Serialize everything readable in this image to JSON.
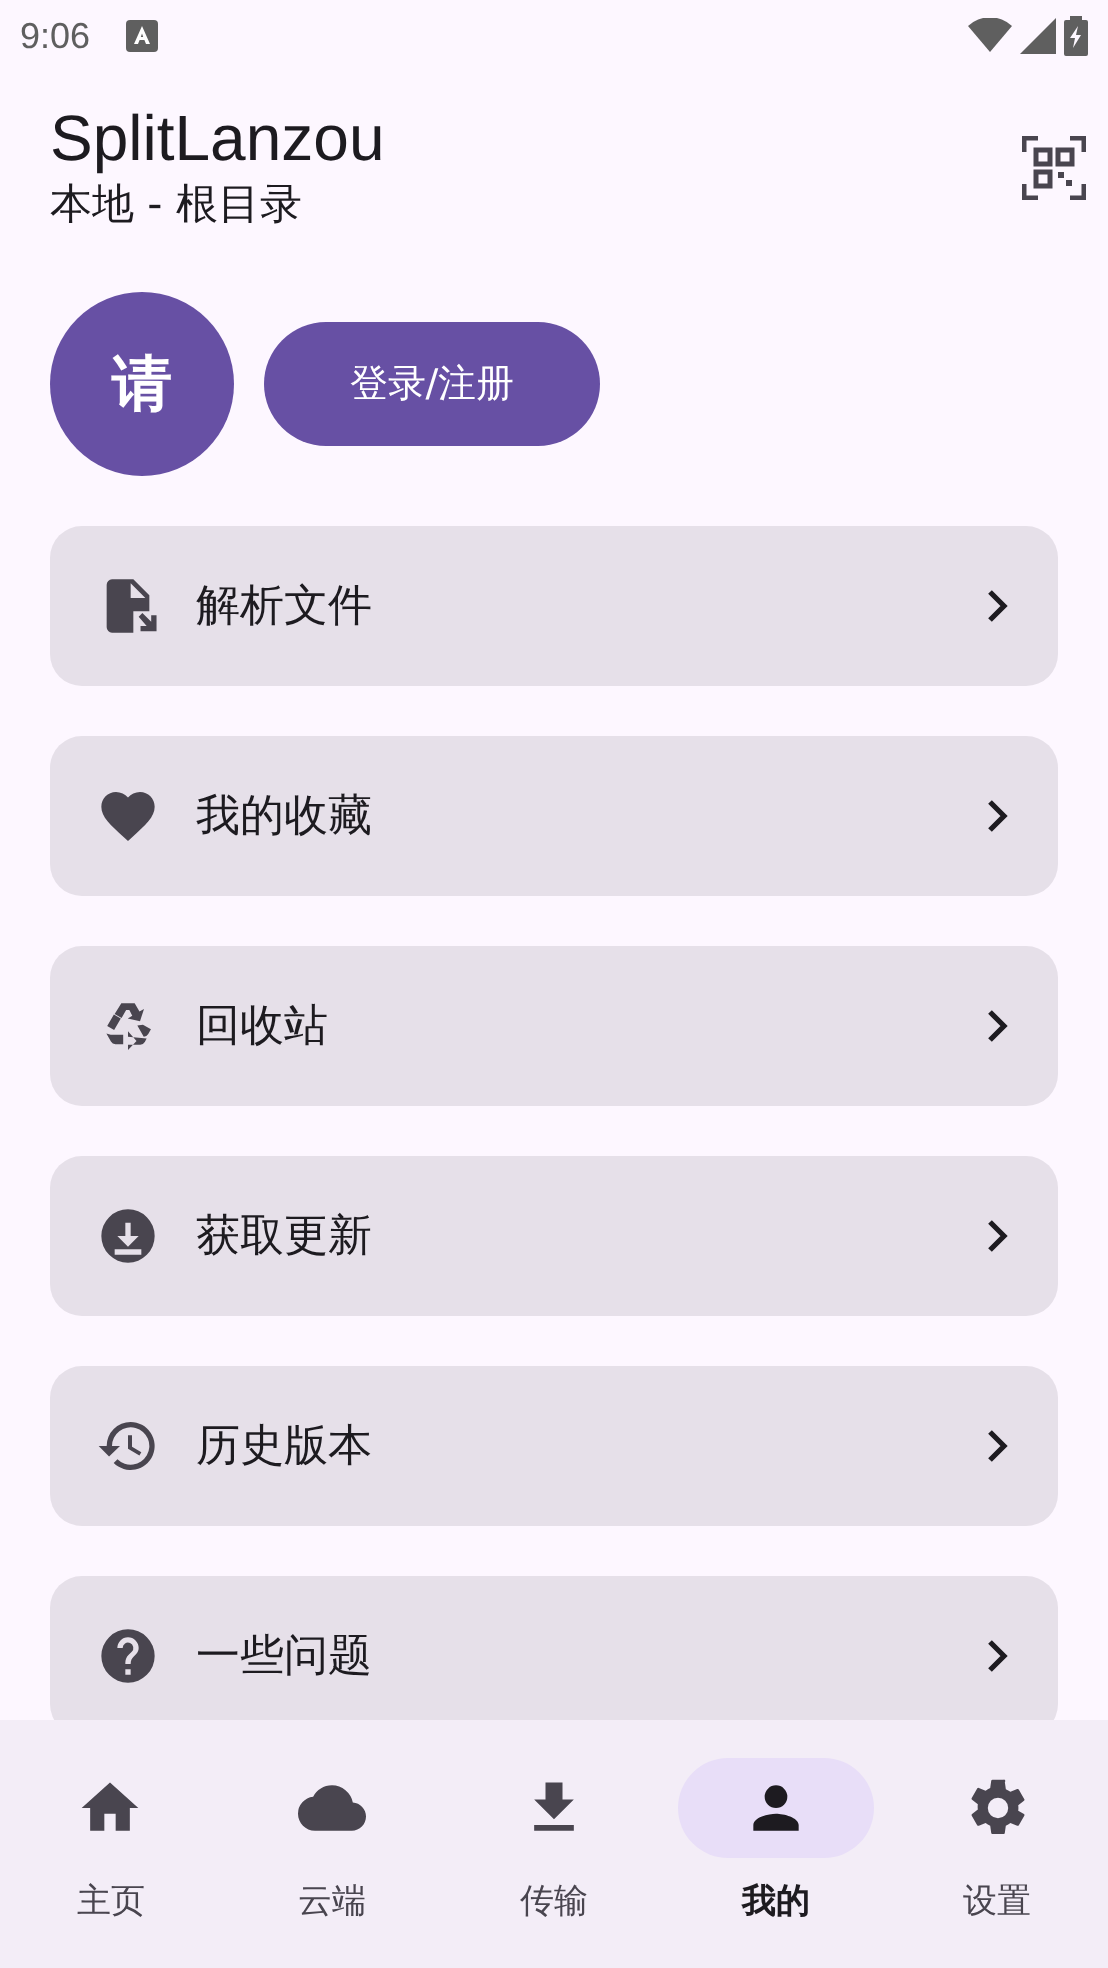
{
  "status_bar": {
    "time": "9:06"
  },
  "header": {
    "title": "SplitLanzou",
    "subtitle": "本地 - 根目录"
  },
  "profile": {
    "avatar": "请",
    "login_button": "登录/注册"
  },
  "menu": [
    {
      "kind": "file",
      "label": "解析文件"
    },
    {
      "kind": "heart",
      "label": "我的收藏"
    },
    {
      "kind": "recycle",
      "label": "回收站"
    },
    {
      "kind": "download",
      "label": "获取更新"
    },
    {
      "kind": "history",
      "label": "历史版本"
    },
    {
      "kind": "help",
      "label": "一些问题"
    }
  ],
  "nav": [
    {
      "kind": "home",
      "label": "主页",
      "selected": false
    },
    {
      "kind": "cloud",
      "label": "云端",
      "selected": false
    },
    {
      "kind": "transfer",
      "label": "传输",
      "selected": false
    },
    {
      "kind": "person",
      "label": "我的",
      "selected": true
    },
    {
      "kind": "settings",
      "label": "设置",
      "selected": false
    }
  ]
}
